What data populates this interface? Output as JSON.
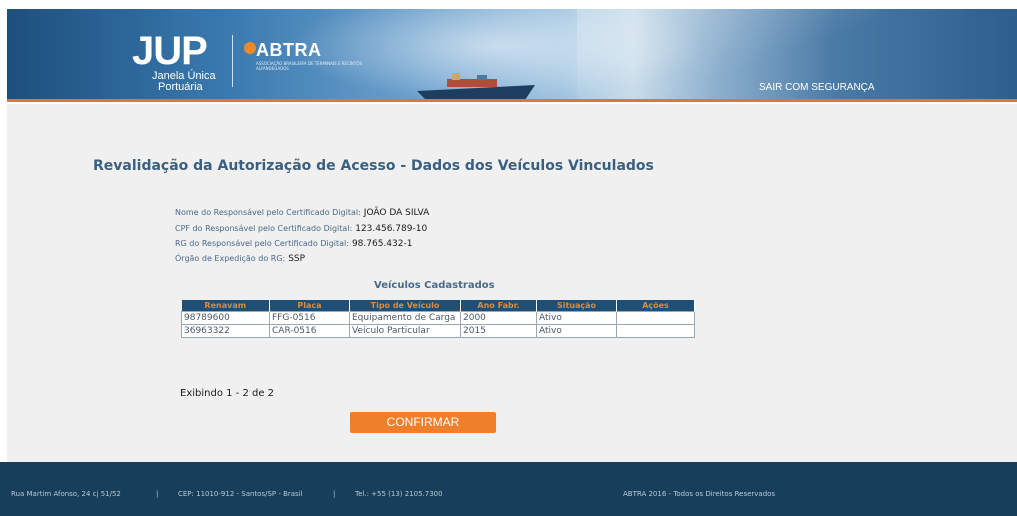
{
  "header": {
    "logo_main": "JUP",
    "logo_sub_line1": "Janela Única",
    "logo_sub_line2": "Portuária",
    "partner_name": "ABTRA",
    "partner_tagline": "ASSOCIAÇÃO BRASILEIRA DE TERMINAIS E RECINTOS ALFANDEGADOS",
    "logout_label": "SAIR COM SEGURANÇA"
  },
  "page_title": "Revalidação da Autorização de Acesso - Dados dos Veículos Vinculados",
  "info": {
    "name_label": "Nome do Responsável pelo Certificado Digital:",
    "name_value": "JOÃO DA SILVA",
    "cpf_label": "CPF do Responsável pelo Certificado Digital:",
    "cpf_value": "123.456.789-10",
    "rg_label": "RG do Responsável pelo Certificado Digital:",
    "rg_value": "98.765.432-1",
    "org_label": "Órgão de Expedição do RG:",
    "org_value": "SSP"
  },
  "vehicles": {
    "title": "Veículos Cadastrados",
    "columns": [
      "Renavam",
      "Placa",
      "Tipo de Veículo",
      "Ano Fabr.",
      "Situação",
      "Ações"
    ],
    "rows": [
      [
        "98789600",
        "FFG-0516",
        "Equipamento de Carga",
        "2000",
        "Ativo",
        ""
      ],
      [
        "36963322",
        "CAR-0516",
        "Veículo Particular",
        "2015",
        "Ativo",
        ""
      ]
    ]
  },
  "paging_text": "Exibindo 1 - 2 de 2",
  "confirm_label": "CONFIRMAR",
  "footer": {
    "address": "Rua Martim Afonso, 24 cj 51/52",
    "sep1": "|",
    "cep": "CEP: 11010-912 - Santos/SP - Brasil",
    "sep2": "|",
    "phone": "Tel.: +55 (13) 2105.7300",
    "copyright": "ABTRA 2016 - Todos os Direitos Reservados"
  },
  "colors": {
    "accent": "#ef7f2a",
    "header_dark": "#1f4f74",
    "footer_bg": "#173e5a"
  }
}
